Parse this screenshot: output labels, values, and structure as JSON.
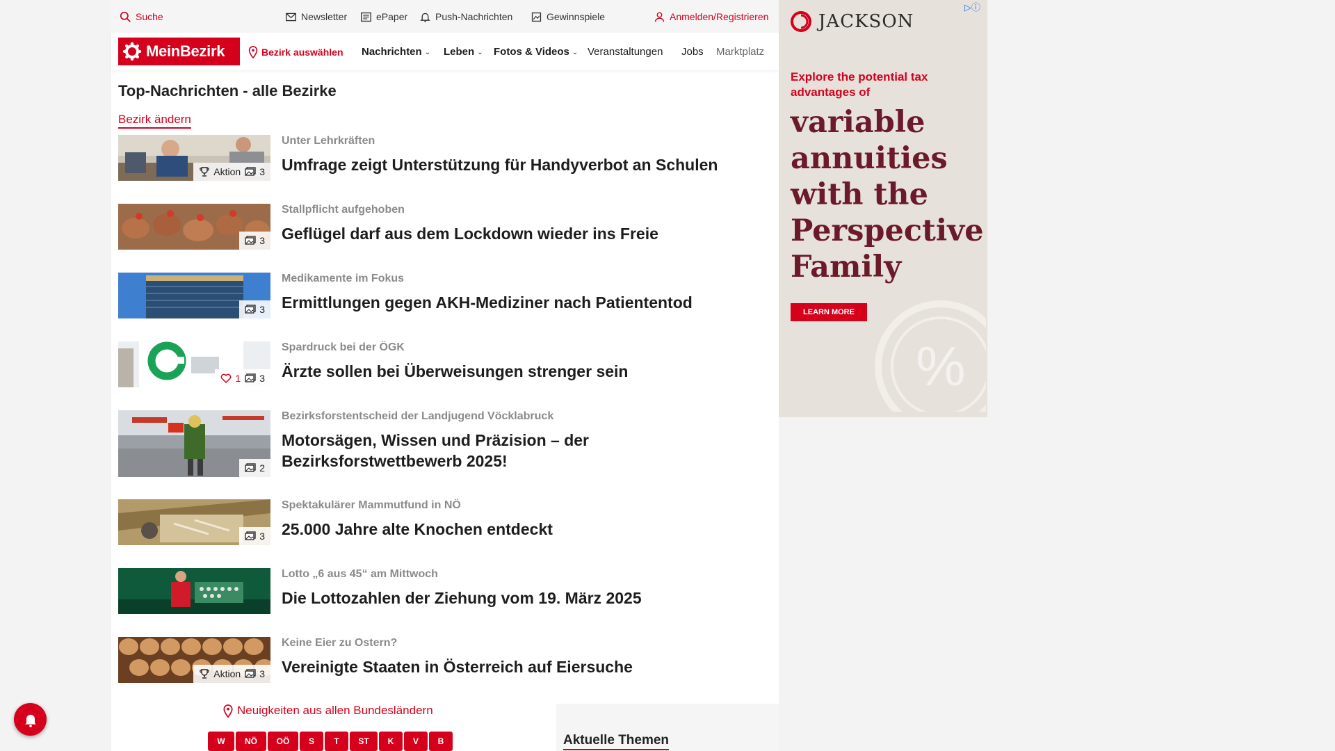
{
  "utility": {
    "search": "Suche",
    "newsletter": "Newsletter",
    "epaper": "ePaper",
    "push": "Push-Nachrichten",
    "games": "Gewinnspiele",
    "login": "Anmelden/Registrieren"
  },
  "nav": {
    "logo": "MeinBezirk",
    "select_district": "Bezirk auswählen",
    "items": [
      "Nachrichten",
      "Leben",
      "Fotos & Videos",
      "Veranstaltungen",
      "Jobs",
      "Marktplatz"
    ]
  },
  "main": {
    "title": "Top-Nachrichten - alle Bezirke",
    "change_district": "Bezirk ändern",
    "articles": [
      {
        "kicker": "Unter Lehrkräften",
        "headline": "Umfrage zeigt Unterstützung für Handyverbot an Schulen",
        "badge_label": "Aktion",
        "likes": "",
        "photos": "3"
      },
      {
        "kicker": "Stallpflicht aufgehoben",
        "headline": "Geflügel darf aus dem Lockdown wieder ins Freie",
        "badge_label": "",
        "likes": "",
        "photos": "3"
      },
      {
        "kicker": "Medikamente im Fokus",
        "headline": "Ermittlungen gegen AKH-Mediziner nach Patiententod",
        "badge_label": "",
        "likes": "",
        "photos": "3"
      },
      {
        "kicker": "Spardruck bei der ÖGK",
        "headline": "Ärzte sollen bei Überweisungen strenger sein",
        "badge_label": "",
        "likes": "1",
        "photos": "3"
      },
      {
        "kicker": "Bezirksforstentscheid der Landjugend Vöcklabruck",
        "headline": "Motorsägen, Wissen und Präzision – der Bezirksforstwettbewerb 2025!",
        "badge_label": "",
        "likes": "",
        "photos": "2"
      },
      {
        "kicker": "Spektakulärer Mammutfund in NÖ",
        "headline": "25.000 Jahre alte Knochen entdeckt",
        "badge_label": "",
        "likes": "",
        "photos": "3"
      },
      {
        "kicker": "Lotto „6 aus 45“ am Mittwoch",
        "headline": "Die Lottozahlen der Ziehung vom 19. März 2025",
        "badge_label": "",
        "likes": "",
        "photos": ""
      },
      {
        "kicker": "Keine Eier zu Ostern?",
        "headline": "Vereinigte Staaten in Österreich auf Eiersuche",
        "badge_label": "Aktion",
        "likes": "",
        "photos": "3"
      }
    ]
  },
  "ad": {
    "brand": "JACKSON",
    "subtitle": "Explore the potential tax advantages of",
    "headline": "variable annuities with the Perspective Family",
    "button": "LEARN MORE",
    "symbol": "%"
  },
  "bottom": {
    "news_link": "Neuigkeiten aus allen Bundesländern",
    "states": [
      "W",
      "NÖ",
      "OÖ",
      "S",
      "T",
      "ST",
      "K",
      "V",
      "B"
    ],
    "themes_title": "Aktuelle Themen"
  },
  "colors": {
    "brand_red": "#d5001c",
    "ad_text": "#6b1a2a",
    "ad_bg": "#e7e1db"
  }
}
